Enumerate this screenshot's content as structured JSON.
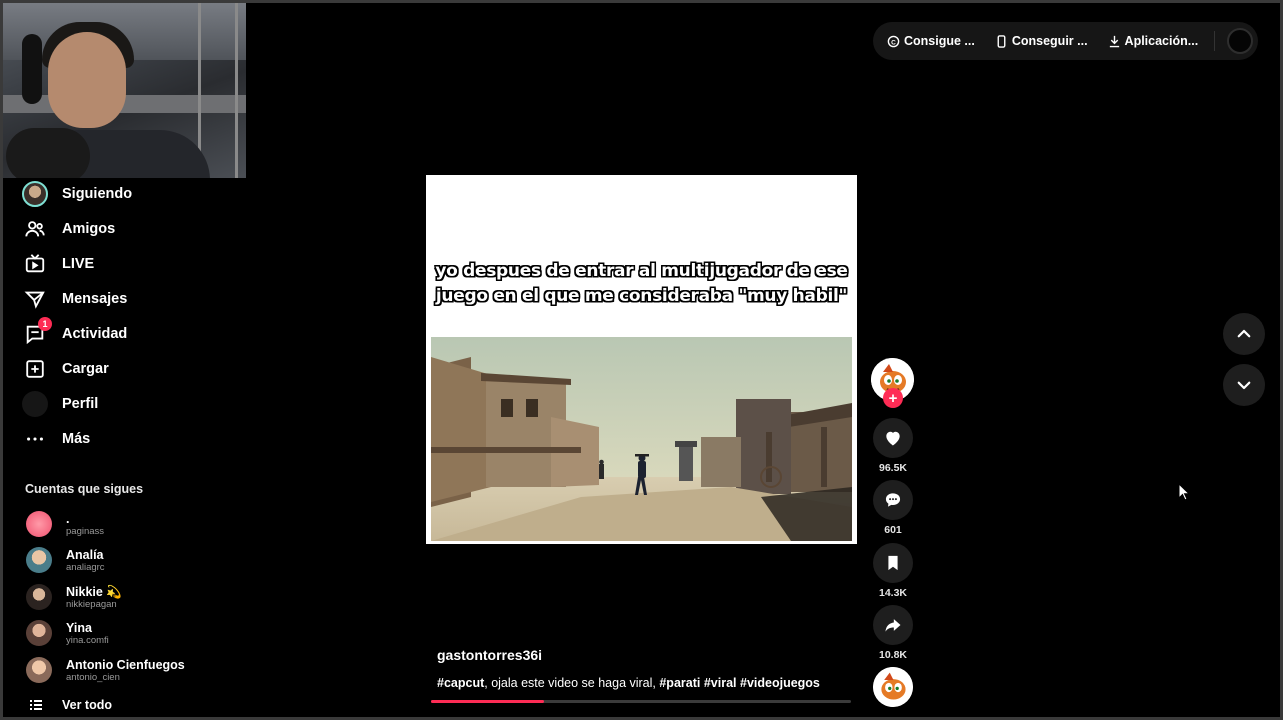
{
  "sidebar": {
    "nav": [
      {
        "label": "Siguiendo",
        "icon": "avatar-icon"
      },
      {
        "label": "Amigos",
        "icon": "friends-icon"
      },
      {
        "label": "LIVE",
        "icon": "live-icon"
      },
      {
        "label": "Mensajes",
        "icon": "messages-icon"
      },
      {
        "label": "Actividad",
        "icon": "activity-icon",
        "badge": "1"
      },
      {
        "label": "Cargar",
        "icon": "upload-icon"
      },
      {
        "label": "Perfil",
        "icon": "profile-avatar-icon"
      },
      {
        "label": "Más",
        "icon": "more-icon"
      }
    ],
    "following_title": "Cuentas que sigues",
    "accounts": [
      {
        "name": ".",
        "handle": "paginass"
      },
      {
        "name": "Analía",
        "handle": "analiagrc"
      },
      {
        "name": "Nikkie 💫",
        "handle": "nikkiepagan"
      },
      {
        "name": "Yina",
        "handle": "yina.comfi"
      },
      {
        "name": "Antonio Cienfuegos",
        "handle": "antonio_cien"
      }
    ],
    "see_all": "Ver todo"
  },
  "top_bar": {
    "coins": "Consigue ...",
    "get_app": "Conseguir ...",
    "download": "Aplicación..."
  },
  "video": {
    "overlay_text": "yo despues de entrar al multijugador de ese juego en el que me consideraba \"muy habil\"",
    "author": "gastontorres36i",
    "description_parts": [
      {
        "text": "#capcut",
        "tag": true
      },
      {
        "text": ", ojala este video se haga viral, ",
        "tag": false
      },
      {
        "text": "#parati",
        "tag": true
      },
      {
        "text": " ",
        "tag": false
      },
      {
        "text": "#viral",
        "tag": true
      },
      {
        "text": " ",
        "tag": false
      },
      {
        "text": "#videojuegos",
        "tag": true
      }
    ],
    "progress": 0.27
  },
  "actions": {
    "likes": "96.5K",
    "comments": "601",
    "saves": "14.3K",
    "shares": "10.8K"
  },
  "colors": {
    "accent": "#fe2c55",
    "background": "#000000",
    "button_bg": "#1e1e1e"
  }
}
